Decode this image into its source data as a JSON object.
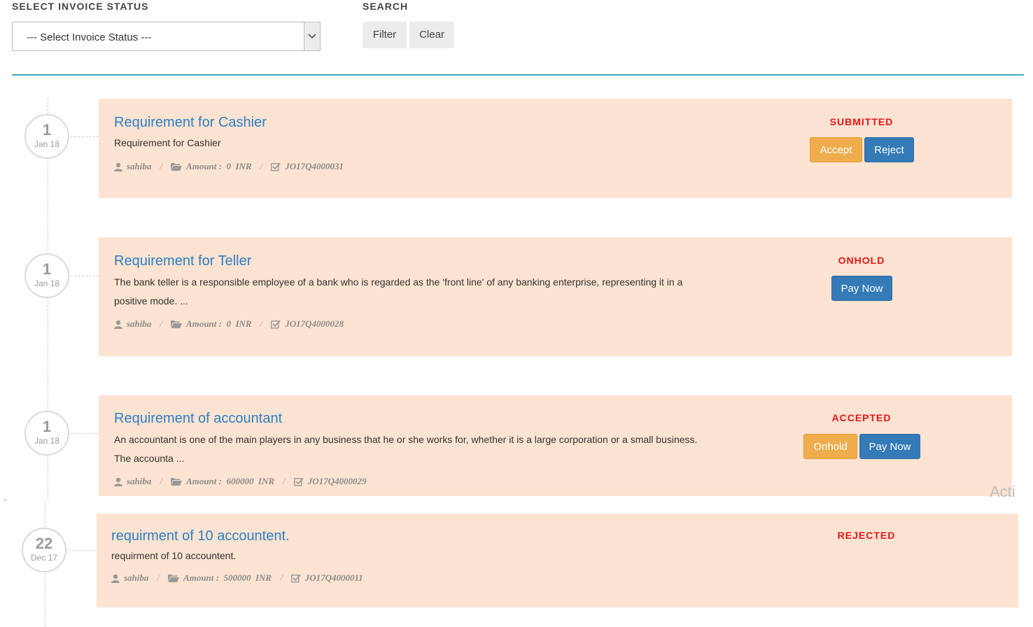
{
  "filters": {
    "status_label": "SELECT INVOICE STATUS",
    "status_placeholder": "--- Select Invoice Status ---",
    "search_label": "SEARCH",
    "filter_button": "Filter",
    "clear_button": "Clear"
  },
  "meta_labels": {
    "amount": "Amount :",
    "currency": "INR",
    "separator": "/"
  },
  "invoices": [
    {
      "day": "1",
      "month": "Jan 18",
      "title": "Requirement for Cashier",
      "description": "Requirement for Cashier",
      "user": "sahiba",
      "amount": "0",
      "code": "JO17Q4000031",
      "status": "SUBMITTED",
      "actions": [
        "Accept",
        "Reject"
      ]
    },
    {
      "day": "1",
      "month": "Jan 18",
      "title": "Requirement for Teller",
      "description": "The bank teller is a responsible employee of a bank who is regarded as the 'front line' of any banking enterprise, representing it in a positive mode. ...",
      "user": "sahiba",
      "amount": "0",
      "code": "JO17Q4000028",
      "status": "ONHOLD",
      "actions": [
        "Pay Now"
      ]
    },
    {
      "day": "1",
      "month": "Jan 18",
      "title": "Requirement of accountant",
      "description": "An accountant is one of the main players in any business that he or she works for, whether it is a large corporation or a small business. The accounta ...",
      "user": "sahiba",
      "amount": "600000",
      "code": "JO17Q4000029",
      "status": "ACCEPTED",
      "actions": [
        "Onhold",
        "Pay Now"
      ]
    },
    {
      "day": "22",
      "month": "Dec 17",
      "title": "requirment of 10 accountent.",
      "description": "requirment of 10 accountent.",
      "user": "sahiba",
      "amount": "500000",
      "code": "JO17Q4000011",
      "status": "REJECTED",
      "actions": []
    }
  ],
  "watermark": "Acti",
  "colors": {
    "card_bg": "#fde3d1",
    "title": "#2b7fc3",
    "status": "#e8141b",
    "warning_button": "#efad4e",
    "primary_button": "#337ab7",
    "divider": "#3da6c7"
  }
}
